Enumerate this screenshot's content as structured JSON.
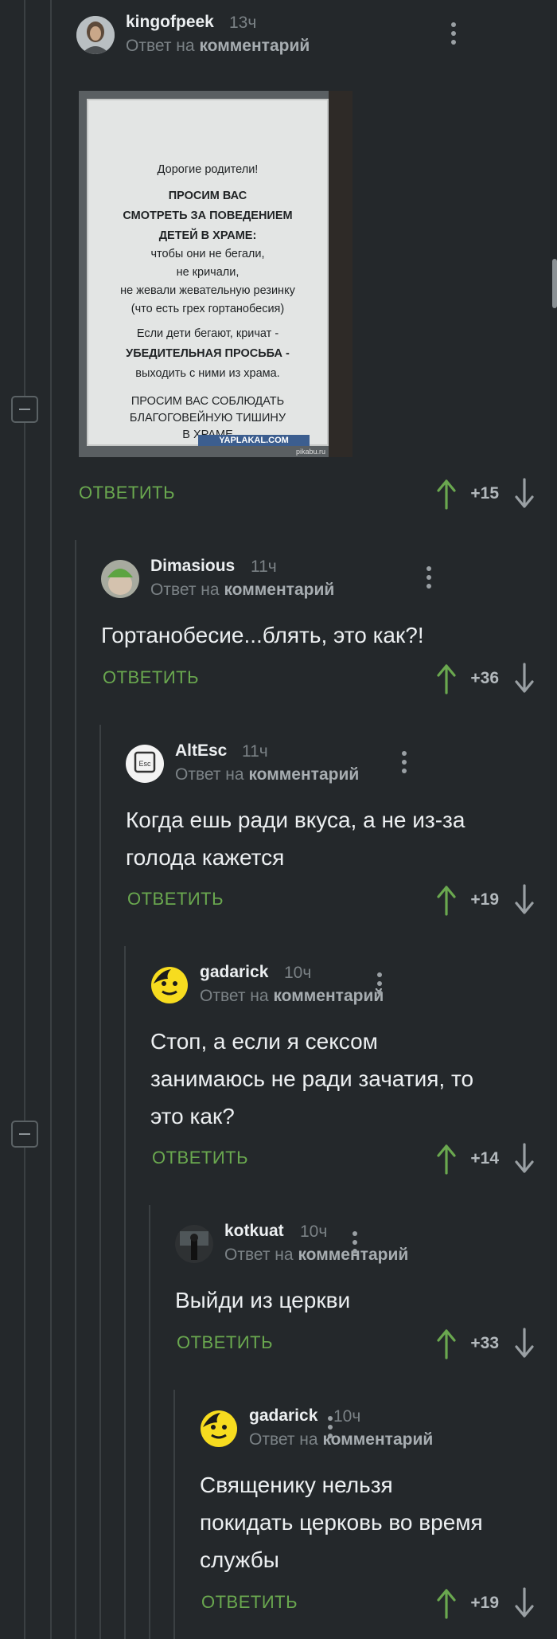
{
  "reply_to_prefix": "Ответ на",
  "reply_to_target": "комментарий",
  "reply_label": "ОТВЕТИТЬ",
  "post_image": {
    "lines": [
      "Дорогие родители!",
      "ПРОСИМ ВАС",
      "СМОТРЕТЬ ЗА ПОВЕДЕНИЕМ",
      "ДЕТЕЙ В ХРАМЕ:",
      "чтобы они не бегали,",
      "не кричали,",
      "не жевали жевательную резинку",
      "(что есть грех гортанобесия)",
      "Если дети бегают, кричат -",
      "УБЕДИТЕЛЬНАЯ ПРОСЬБА -",
      "выходить с ними из храма.",
      "ПРОСИМ ВАС СОБЛЮДАТЬ",
      "БЛАГОГОВЕЙНУЮ ТИШИНУ",
      "В ХРАМЕ"
    ],
    "watermark": "YAPLAKAL.COM",
    "watermark2": "pikabu.ru"
  },
  "comments": [
    {
      "username": "kingofpeek",
      "time": "13ч",
      "text": "",
      "score": "+15"
    },
    {
      "username": "Dimasious",
      "time": "11ч",
      "text": "Гортанобесие...блять, это как?!",
      "score": "+36"
    },
    {
      "username": "AltEsc",
      "time": "11ч",
      "text": "Когда ешь ради вкуса, а не из-за\nголода кажется",
      "score": "+19"
    },
    {
      "username": "gadarick",
      "time": "10ч",
      "text": "Стоп, а если я сексом\nзанимаюсь не ради зачатия, то\nэто как?",
      "score": "+14"
    },
    {
      "username": "kotkuat",
      "time": "10ч",
      "text": "Выйди из церкви",
      "score": "+33"
    },
    {
      "username": "gadarick",
      "time": "10ч",
      "text": "Священику нельзя\nпокидать церковь во время\nслужбы",
      "score": "+19"
    }
  ]
}
